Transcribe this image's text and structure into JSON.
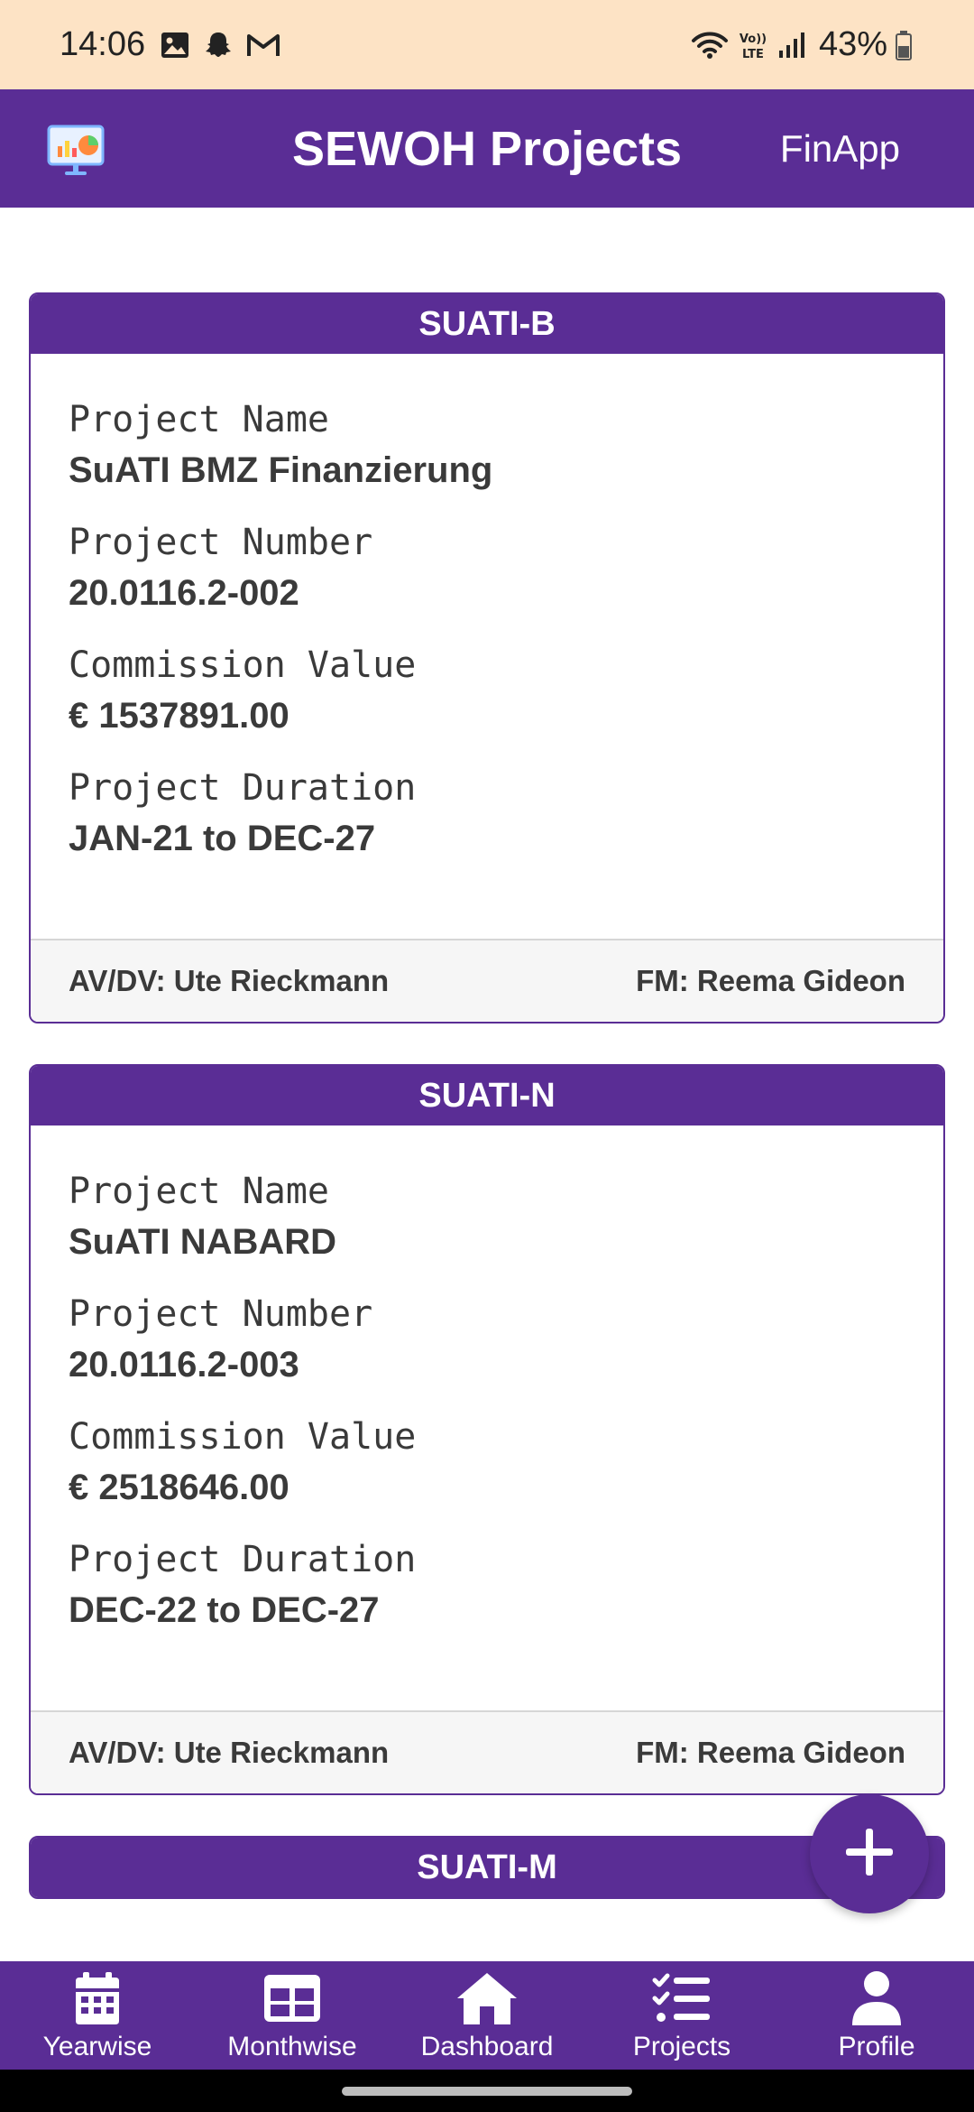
{
  "status_bar": {
    "time": "14:06",
    "left_icons": [
      "gallery-icon",
      "snapchat-icon",
      "gmail-icon"
    ],
    "right_icons": [
      "wifi-icon",
      "volte-icon",
      "signal-icon"
    ],
    "battery_percent": "43%"
  },
  "app_bar": {
    "title": "SEWOH Projects",
    "right_label": "FinApp",
    "logo": "presentation-chart-icon"
  },
  "projects": [
    {
      "code": "SUATI-B",
      "name_label": "Project Name",
      "name": "SuATI BMZ Finanzierung",
      "number_label": "Project Number",
      "number": "20.0116.2-002",
      "commission_label": "Commission Value",
      "commission": "€ 1537891.00",
      "duration_label": "Project Duration",
      "duration": "JAN-21 to DEC-27",
      "avdv": "AV/DV: Ute Rieckmann",
      "fm": "FM: Reema Gideon"
    },
    {
      "code": "SUATI-N",
      "name_label": "Project Name",
      "name": "SuATI NABARD",
      "number_label": "Project Number",
      "number": "20.0116.2-003",
      "commission_label": "Commission Value",
      "commission": "€ 2518646.00",
      "duration_label": "Project Duration",
      "duration": "DEC-22 to DEC-27",
      "avdv": "AV/DV: Ute Rieckmann",
      "fm": "FM: Reema Gideon"
    },
    {
      "code": "SUATI-M"
    }
  ],
  "fab": {
    "icon": "plus-icon"
  },
  "bottom_nav": [
    {
      "label": "Yearwise",
      "icon": "calendar-icon"
    },
    {
      "label": "Monthwise",
      "icon": "table-grid-icon"
    },
    {
      "label": "Dashboard",
      "icon": "home-icon"
    },
    {
      "label": "Projects",
      "icon": "checklist-icon"
    },
    {
      "label": "Profile",
      "icon": "user-icon"
    }
  ],
  "colors": {
    "primary": "#5a2d95",
    "status_bar_bg": "#fde3c5",
    "footer_bg": "#f6f6f6",
    "text": "#3a3a3a"
  }
}
